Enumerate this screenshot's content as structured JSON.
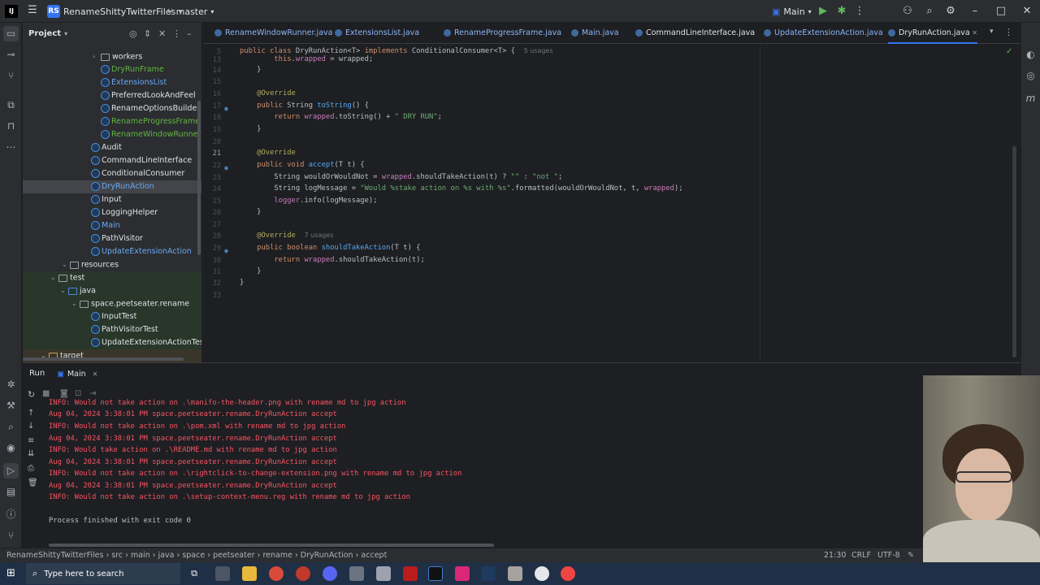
{
  "titlebar": {
    "project_badge": "RS",
    "project_name": "RenameShittyTwitterFiles",
    "branch": "master",
    "run_config": "Main"
  },
  "project_panel": {
    "title": "Project",
    "tree": [
      {
        "label": "workers",
        "kind": "folder",
        "indent": 0
      },
      {
        "label": "DryRunFrame",
        "kind": "class",
        "color": "green"
      },
      {
        "label": "ExtensionsList",
        "kind": "class",
        "color": "blue"
      },
      {
        "label": "PreferredLookAndFeel",
        "kind": "class",
        "color": "white"
      },
      {
        "label": "RenameOptionsBuilder",
        "kind": "class",
        "color": "white"
      },
      {
        "label": "RenameProgressFrame",
        "kind": "class",
        "color": "green"
      },
      {
        "label": "RenameWindowRunner",
        "kind": "class",
        "color": "green"
      },
      {
        "label": "Audit",
        "kind": "annotation",
        "color": "white"
      },
      {
        "label": "CommandLineInterface",
        "kind": "class",
        "color": "white"
      },
      {
        "label": "ConditionalConsumer",
        "kind": "interface",
        "color": "white"
      },
      {
        "label": "DryRunAction",
        "kind": "class",
        "color": "blue",
        "selected": true
      },
      {
        "label": "Input",
        "kind": "class",
        "color": "white"
      },
      {
        "label": "LoggingHelper",
        "kind": "class",
        "color": "white"
      },
      {
        "label": "Main",
        "kind": "class",
        "color": "blue"
      },
      {
        "label": "PathVisitor",
        "kind": "class",
        "color": "white"
      },
      {
        "label": "UpdateExtensionAction",
        "kind": "class",
        "color": "blue"
      },
      {
        "label": "resources",
        "kind": "folder"
      },
      {
        "label": "test",
        "kind": "folder"
      },
      {
        "label": "java",
        "kind": "folder"
      },
      {
        "label": "space.peetseater.rename",
        "kind": "package"
      },
      {
        "label": "InputTest",
        "kind": "class",
        "color": "white"
      },
      {
        "label": "PathVisitorTest",
        "kind": "class",
        "color": "white"
      },
      {
        "label": "UpdateExtensionActionTest",
        "kind": "class",
        "color": "white"
      },
      {
        "label": "target",
        "kind": "folder"
      }
    ]
  },
  "tabs": [
    "RenameWindowRunner.java",
    "ExtensionsList.java",
    "RenameProgressFrame.java",
    "Main.java",
    "CommandLineInterface.java",
    "UpdateExtensionAction.java",
    "DryRunAction.java"
  ],
  "editor": {
    "current_line": "21",
    "lines": [
      {
        "n": "5",
        "parts": [
          [
            "kw",
            "public class "
          ],
          [
            "",
            "DryRunAction"
          ],
          [
            "",
            "<"
          ],
          [
            "",
            "T"
          ],
          [
            "",
            "> "
          ],
          [
            "kw",
            "implements "
          ],
          [
            "",
            "ConditionalConsumer<T> {  "
          ],
          [
            "hint",
            "5 usages"
          ]
        ]
      },
      {
        "n": "13",
        "parts": [
          [
            "",
            "        "
          ],
          [
            "kw",
            "this"
          ],
          [
            "",
            "."
          ],
          [
            "fd",
            "wrapped"
          ],
          [
            "",
            " = wrapped;"
          ]
        ]
      },
      {
        "n": "14",
        "parts": [
          [
            "",
            "    }"
          ]
        ]
      },
      {
        "n": "15",
        "parts": [
          [
            "",
            ""
          ]
        ]
      },
      {
        "n": "16",
        "parts": [
          [
            "an",
            "    @Override"
          ]
        ]
      },
      {
        "n": "17",
        "parts": [
          [
            "kw",
            "    public "
          ],
          [
            "",
            "String "
          ],
          [
            "fn",
            "toString"
          ],
          [
            "",
            "() {"
          ]
        ]
      },
      {
        "n": "18",
        "parts": [
          [
            "kw",
            "        return "
          ],
          [
            "fd",
            "wrapped"
          ],
          [
            "",
            ".toString() + "
          ],
          [
            "st",
            "\" DRY RUN\""
          ],
          [
            "",
            ";"
          ]
        ]
      },
      {
        "n": "19",
        "parts": [
          [
            "",
            "    }"
          ]
        ]
      },
      {
        "n": "20",
        "parts": [
          [
            "",
            ""
          ]
        ]
      },
      {
        "n": "21",
        "parts": [
          [
            "an",
            "    @Override"
          ]
        ]
      },
      {
        "n": "22",
        "parts": [
          [
            "kw",
            "    public void "
          ],
          [
            "fn",
            "accept"
          ],
          [
            "",
            "(T t) {"
          ]
        ]
      },
      {
        "n": "23",
        "parts": [
          [
            "",
            "        String wouldOrWouldNot = "
          ],
          [
            "fd",
            "wrapped"
          ],
          [
            "",
            ".shouldTakeAction(t) ? "
          ],
          [
            "st",
            "\"\""
          ],
          [
            "",
            " : "
          ],
          [
            "st",
            "\"not \""
          ],
          [
            "",
            ";"
          ]
        ]
      },
      {
        "n": "24",
        "parts": [
          [
            "",
            "        String logMessage = "
          ],
          [
            "st",
            "\"Would %stake action on %s with %s\""
          ],
          [
            "",
            ".formatted(wouldOrWouldNot, t, "
          ],
          [
            "fd",
            "wrapped"
          ],
          [
            "",
            ");"
          ]
        ]
      },
      {
        "n": "25",
        "parts": [
          [
            "",
            "        "
          ],
          [
            "fd",
            "logger"
          ],
          [
            "",
            ".info(logMessage);"
          ]
        ]
      },
      {
        "n": "26",
        "parts": [
          [
            "",
            "    }"
          ]
        ]
      },
      {
        "n": "27",
        "parts": [
          [
            "",
            ""
          ]
        ]
      },
      {
        "n": "28",
        "parts": [
          [
            "an",
            "    @Override  "
          ],
          [
            "hint",
            "7 usages"
          ]
        ]
      },
      {
        "n": "29",
        "parts": [
          [
            "kw",
            "    public boolean "
          ],
          [
            "fn",
            "shouldTakeAction"
          ],
          [
            "",
            "(T t) {"
          ]
        ]
      },
      {
        "n": "30",
        "parts": [
          [
            "kw",
            "        return "
          ],
          [
            "fd",
            "wrapped"
          ],
          [
            "",
            ".shouldTakeAction(t);"
          ]
        ]
      },
      {
        "n": "31",
        "parts": [
          [
            "",
            "    }"
          ]
        ]
      },
      {
        "n": "32",
        "parts": [
          [
            "",
            "}"
          ]
        ]
      },
      {
        "n": "33",
        "parts": [
          [
            "",
            ""
          ]
        ]
      }
    ]
  },
  "run_panel": {
    "title": "Run",
    "tab": "Main",
    "output": [
      {
        "text": "INFO: Would not take action on .\\manifo-the-header.png with rename md to jpg action",
        "color": "red"
      },
      {
        "text": "Aug 04, 2024 3:38:01 PM space.peetseater.rename.DryRunAction accept",
        "color": "red"
      },
      {
        "text": "INFO: Would not take action on .\\pom.xml with rename md to jpg action",
        "color": "red"
      },
      {
        "text": "Aug 04, 2024 3:38:01 PM space.peetseater.rename.DryRunAction accept",
        "color": "red"
      },
      {
        "text": "INFO: Would take action on .\\README.md with rename md to jpg action",
        "color": "red"
      },
      {
        "text": "Aug 04, 2024 3:38:01 PM space.peetseater.rename.DryRunAction accept",
        "color": "red"
      },
      {
        "text": "INFO: Would not take action on .\\rightclick-to-change-extension.png with rename md to jpg action",
        "color": "red"
      },
      {
        "text": "Aug 04, 2024 3:38:01 PM space.peetseater.rename.DryRunAction accept",
        "color": "red"
      },
      {
        "text": "INFO: Would not take action on .\\setup-context-menu.reg with rename md to jpg action",
        "color": "red"
      },
      {
        "text": "",
        "color": "white"
      },
      {
        "text": "Process finished with exit code 0",
        "color": "white"
      }
    ]
  },
  "statusbar": {
    "breadcrumb": [
      "RenameShittyTwitterFiles",
      "src",
      "main",
      "java",
      "space",
      "peetseater",
      "rename",
      "DryRunAction",
      "accept"
    ],
    "position": "21:30",
    "line_sep": "CRLF",
    "encoding": "UTF-8"
  },
  "taskbar": {
    "search_placeholder": "Type here to search"
  }
}
